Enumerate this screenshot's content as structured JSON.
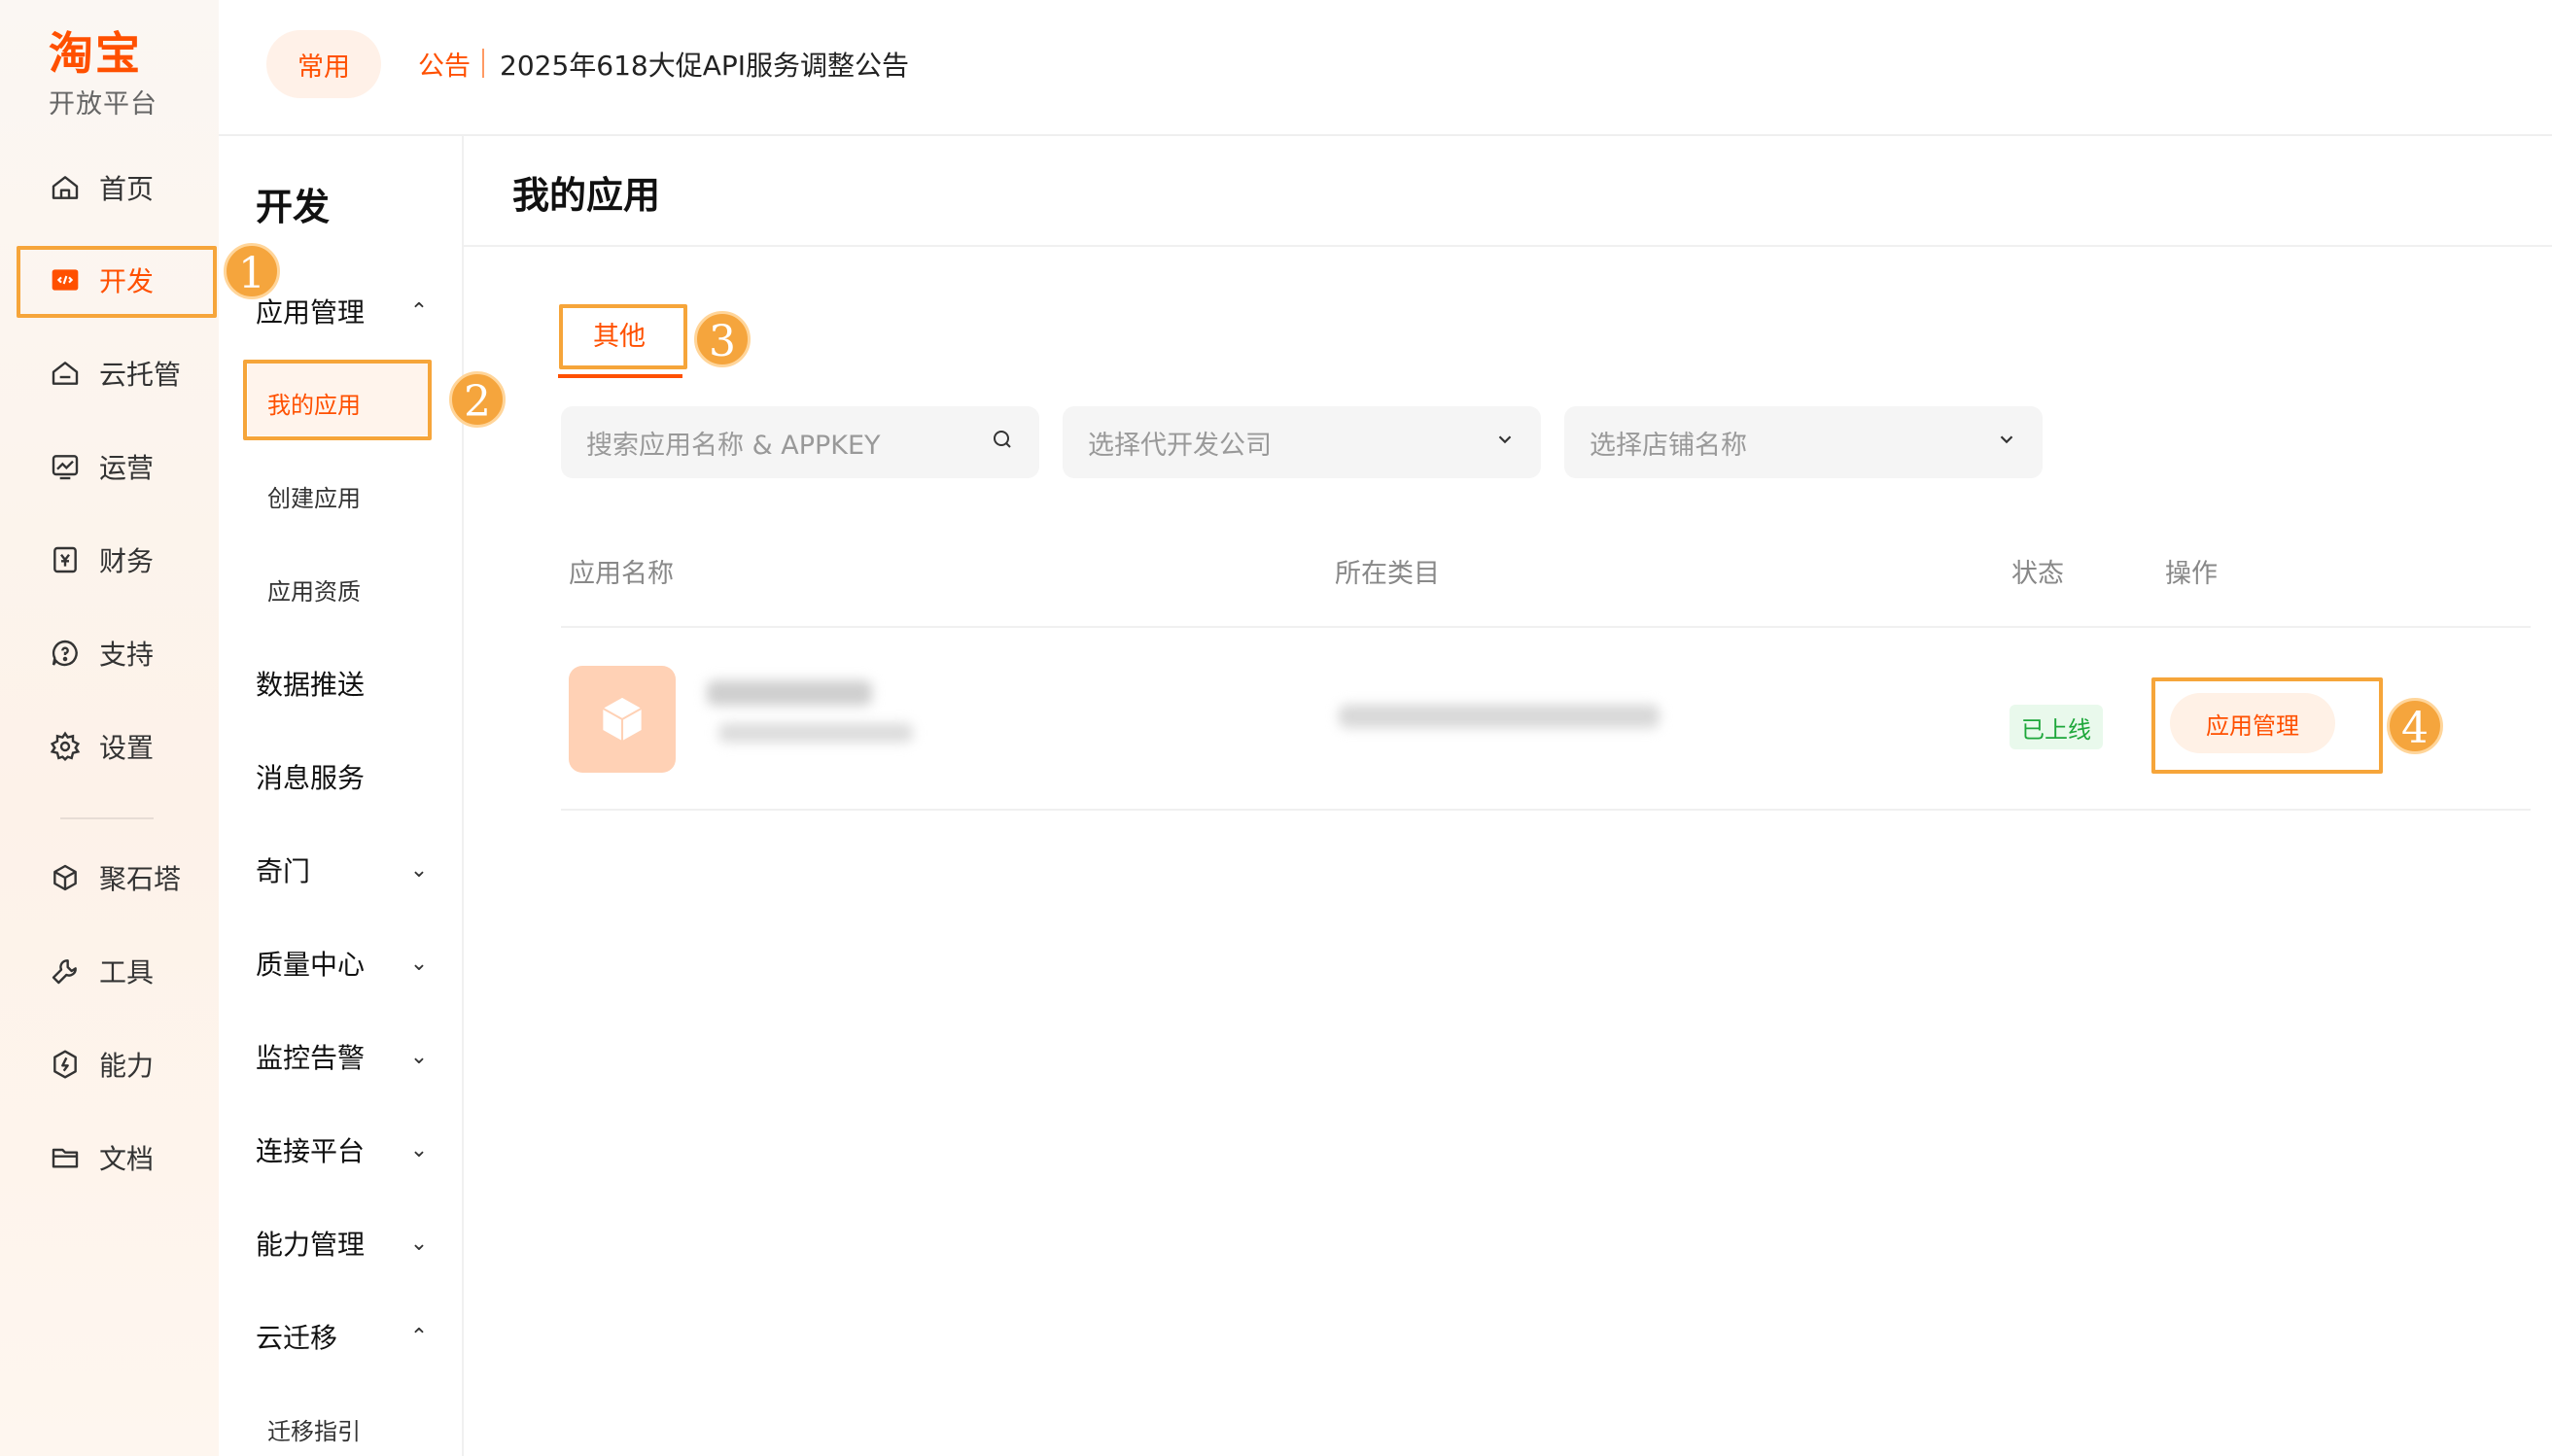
{
  "brand": {
    "name": "淘宝",
    "subtitle": "开放平台"
  },
  "rail": {
    "items": [
      {
        "label": "首页",
        "icon": "home-icon"
      },
      {
        "label": "开发",
        "icon": "code-icon",
        "active": true
      },
      {
        "label": "云托管",
        "icon": "cloud-host-icon"
      },
      {
        "label": "运营",
        "icon": "chart-icon"
      },
      {
        "label": "财务",
        "icon": "yuan-icon"
      },
      {
        "label": "支持",
        "icon": "support-icon"
      },
      {
        "label": "设置",
        "icon": "gear-icon"
      },
      {
        "label": "聚石塔",
        "icon": "cube-icon"
      },
      {
        "label": "工具",
        "icon": "wrench-icon"
      },
      {
        "label": "能力",
        "icon": "ability-icon"
      },
      {
        "label": "文档",
        "icon": "folder-icon"
      }
    ]
  },
  "header": {
    "common_label": "常用",
    "notice_tag": "公告",
    "notice_text": "2025年618大促API服务调整公告"
  },
  "subnav": {
    "title": "开发",
    "app_manage": "应用管理",
    "my_apps": "我的应用",
    "create_app": "创建应用",
    "app_qualification": "应用资质",
    "data_push": "数据推送",
    "message_service": "消息服务",
    "qimen": "奇门",
    "quality_center": "质量中心",
    "monitor_alert": "监控告警",
    "connect_platform": "连接平台",
    "ability_manage": "能力管理",
    "cloud_migration": "云迁移",
    "migration_guide": "迁移指引"
  },
  "main": {
    "title": "我的应用",
    "tab_other": "其他",
    "search_placeholder": "搜索应用名称 & APPKEY",
    "dev_company_placeholder": "选择代开发公司",
    "shop_placeholder": "选择店铺名称",
    "columns": {
      "name": "应用名称",
      "category": "所在类目",
      "status": "状态",
      "action": "操作"
    },
    "row": {
      "status": "已上线",
      "action": "应用管理"
    }
  },
  "annotations": {
    "step1": "1",
    "step2": "2",
    "step3": "3",
    "step4": "4"
  },
  "colors": {
    "accent": "#ff5000",
    "highlight": "#f6a53a",
    "online": "#1ea73b"
  }
}
